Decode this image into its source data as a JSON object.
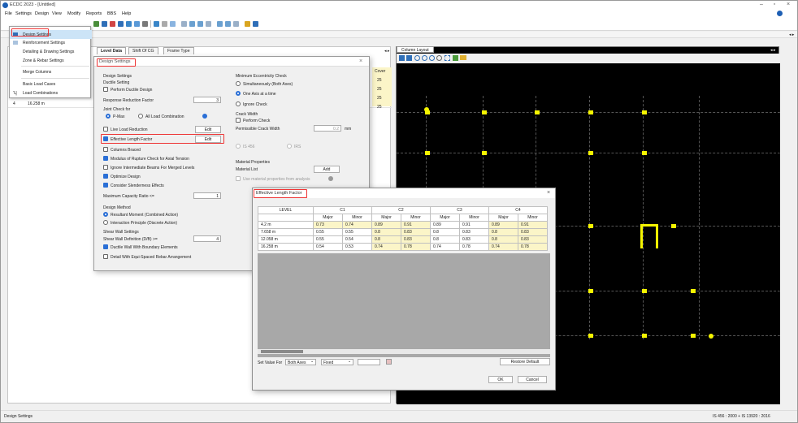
{
  "app": {
    "title": "ECDC 2023 - [Untitled]"
  },
  "menu": [
    "File",
    "Settings",
    "Design",
    "View",
    "Modify",
    "Reports",
    "BBS",
    "Help"
  ],
  "dropdown": [
    "Design Settings",
    "Reinforcement Settings",
    "Detailing & Drawing Settings",
    "Zone & Rebar Settings",
    "Merge Columns",
    "Basic Load Cases",
    "Load Combinations"
  ],
  "left_tabs": [
    "Level Data",
    "Shift Of CG",
    "Frame Type"
  ],
  "level_rows": [
    {
      "num": "4",
      "level": "16.258 m"
    }
  ],
  "cover": {
    "header": "Cover",
    "values": [
      "25",
      "25",
      "25",
      "25"
    ]
  },
  "right_tab": "Column Layout",
  "design_settings": {
    "title": "Design Settings",
    "section": "Design Settings",
    "ductile_setting": "Ductile Setting",
    "perform_ductile": "Perform Ductile Design",
    "response_reduction": "Response Reduction Factor",
    "response_reduction_value": "3",
    "joint_check": "Joint Check for",
    "pmax": "P-Max",
    "all_load": "All Load Combination",
    "live_load": "Live Load Reduction",
    "edit1": "Edit",
    "elf": "Effective Length Factor",
    "edit2": "Edit",
    "braced": "Columns Braced",
    "modulus": "Modulus of Rupture Check for Axial Tension",
    "ignore_beams": "Ignore Intermediate Beams For Merged Levels",
    "optimize": "Optimize Design",
    "slender": "Consider Slenderness Effects",
    "max_cap": "Maximum Capacity Ratio <=",
    "max_cap_value": "1",
    "design_method": "Design Method",
    "resultant": "Resultant Moment (Combined Action)",
    "interaction": "Interaction Principle (Discrete Action)",
    "shear_wall": "Shear Wall Settings",
    "shear_def": "Shear Wall Definition  (D/B)  >=",
    "shear_def_value": "4",
    "ductile_wall": "Ductile Wall With Boundary Elements",
    "detail_equi": "Detail With Equi-Spaced Rebar Arrangement",
    "min_ecc": "Minimum Eccentricity Check",
    "simul": "Simultaneously (Both Axes)",
    "one_axis": "One Axis at a time",
    "ignore_check": "Ignore Check",
    "crack": "Crack Width",
    "perform_check": "Perform Check",
    "perm_crack": "Permissible Crack Width",
    "perm_crack_value": "0.2",
    "mm": "mm",
    "is456": "IS 456",
    "irs": "IRS",
    "mat_props": "Material Properties",
    "mat_list": "Material List",
    "add": "Add",
    "use_mat": "Use material properties from analysis"
  },
  "elf_dialog": {
    "title": "Effective Length Factor",
    "level_header": "LEVEL",
    "columns": [
      "C1",
      "C2",
      "C3",
      "C4"
    ],
    "sub": [
      "Major",
      "Minor"
    ],
    "rows": [
      {
        "level": "4.2 m",
        "v": [
          "0.73",
          "0.74",
          "0.89",
          "0.91",
          "0.89",
          "0.91",
          "0.89",
          "0.91"
        ]
      },
      {
        "level": "7.658 m",
        "v": [
          "0.55",
          "0.55",
          "0.8",
          "0.83",
          "0.8",
          "0.83",
          "0.8",
          "0.83"
        ]
      },
      {
        "level": "12.058 m",
        "v": [
          "0.55",
          "0.54",
          "0.8",
          "0.83",
          "0.8",
          "0.83",
          "0.8",
          "0.83"
        ]
      },
      {
        "level": "16.258 m",
        "v": [
          "0.54",
          "0.53",
          "0.74",
          "0.78",
          "0.74",
          "0.78",
          "0.74",
          "0.78"
        ]
      }
    ],
    "set_value_for": "Set Value For",
    "axes": "Both Axes",
    "mode": "Fixed",
    "restore": "Restore Default",
    "ok": "OK",
    "cancel": "Cancel"
  },
  "status": {
    "left": "Design Settings",
    "right": "IS 456 : 2000 + IS 13920 : 2016"
  },
  "colors": {
    "accent": "#2a6fd6",
    "highlight": "#e33333",
    "column": "#f5f500"
  }
}
